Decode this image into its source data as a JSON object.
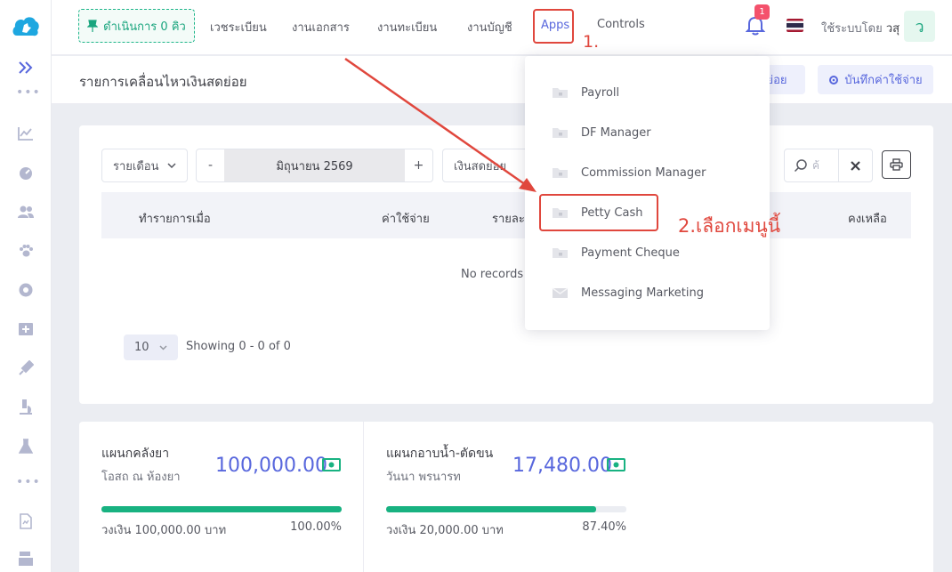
{
  "header": {
    "queue_button": "ดำเนินการ 0 คิว",
    "nav": [
      "เวชระเบียน",
      "งานเอกสาร",
      "งานทะเบียน",
      "งานบัญชี"
    ],
    "apps": "Apps",
    "controls": "Controls",
    "notification_count": "1",
    "user_prefix": "ใช้ระบบโดย",
    "user_name": "วสุ",
    "avatar_initial": "ว"
  },
  "subheader": {
    "title": "รายการเคลื่อนไหวเงินสดย่อย",
    "button1": "ย่อย",
    "button2": "บันทึกค่าใช้จ่าย"
  },
  "filters": {
    "period": "รายเดือน",
    "minus": "-",
    "month": "มิถุนายน 2569",
    "plus": "+",
    "cash": "เงินสดย่อย",
    "search_placeholder": "ค้"
  },
  "table": {
    "headers": [
      "ทำรายการเมื่อ",
      "ค่าใช้จ่าย",
      "รายละ",
      "คงเหลือ"
    ],
    "empty": "No records f",
    "page_size": "10",
    "showing": "Showing 0 - 0 of 0"
  },
  "stats": [
    {
      "title": "แผนกคลังยา",
      "subtitle": "โอสถ ณ ห้องยา",
      "amount": "100,000.00",
      "limit": "วงเงิน 100,000.00 บาท",
      "percent": "100.00%",
      "fill": 1.0
    },
    {
      "title": "แผนกอาบน้ำ-ตัดขน",
      "subtitle": "วันนา พรนารท",
      "amount": "17,480.00",
      "limit": "วงเงิน 20,000.00 บาท",
      "percent": "87.40%",
      "fill": 0.874
    }
  ],
  "dropdown": {
    "items": [
      "Payroll",
      "DF Manager",
      "Commission Manager",
      "Petty Cash",
      "Payment Cheque",
      "Messaging Marketing"
    ]
  },
  "annotations": {
    "step1": "1.",
    "step2": "2.เลือกเมนูนี้"
  },
  "colors": {
    "accent": "#5867dd",
    "success": "#18b281",
    "annotation": "#e0473d"
  }
}
